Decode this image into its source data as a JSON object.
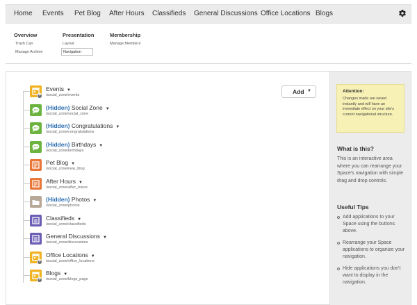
{
  "topnav": {
    "items": [
      "Home",
      "Events",
      "Pet Blog",
      "After Hours",
      "Classifieds",
      "General Discussions",
      "Office Locations",
      "Blogs"
    ]
  },
  "subnav": {
    "overview": {
      "title": "Overview",
      "links": [
        "Trash Can",
        "Manage Archive"
      ]
    },
    "presentation": {
      "title": "Presentation",
      "links": [
        "Layout"
      ],
      "input_value": "Navigation"
    },
    "membership": {
      "title": "Membership",
      "links": [
        "Manage Members"
      ]
    }
  },
  "add_button": {
    "label": "Add"
  },
  "tree": [
    {
      "hidden": "",
      "name": "Events",
      "path": "/social_zone/events",
      "icon": "calendar-icon",
      "color": "#f0b323",
      "plus": true
    },
    {
      "hidden": "(Hidden)",
      "name": "Social Zone",
      "path": "/social_zone/social_zone",
      "icon": "chat-icon",
      "color": "#6cb33f",
      "plus": false
    },
    {
      "hidden": "(Hidden)",
      "name": "Congratulations",
      "path": "/social_zone/congratulations",
      "icon": "chat-icon",
      "color": "#6cb33f",
      "plus": false
    },
    {
      "hidden": "(Hidden)",
      "name": "Birthdays",
      "path": "/social_zone/birthdays",
      "icon": "chat-icon",
      "color": "#6cb33f",
      "plus": false
    },
    {
      "hidden": "",
      "name": "Pet Blog",
      "path": "/social_zone/new_blog",
      "icon": "blog-icon",
      "color": "#e9773a",
      "plus": false
    },
    {
      "hidden": "",
      "name": "After Hours",
      "path": "/social_zone/after_hours",
      "icon": "blog-icon",
      "color": "#e9773a",
      "plus": false
    },
    {
      "hidden": "(Hidden)",
      "name": "Photos",
      "path": "/social_zone/photos",
      "icon": "folder-icon",
      "color": "#b7a898",
      "plus": false
    },
    {
      "hidden": "",
      "name": "Classifieds",
      "path": "/social_zone/classifieds",
      "icon": "list-icon",
      "color": "#6b5fb5",
      "plus": false
    },
    {
      "hidden": "",
      "name": "General Discussions",
      "path": "/social_zone/discussions",
      "icon": "list-icon",
      "color": "#6b5fb5",
      "plus": false
    },
    {
      "hidden": "",
      "name": "Office Locations",
      "path": "/social_zone/office_locations",
      "icon": "calendar-icon",
      "color": "#f0b323",
      "plus": true
    },
    {
      "hidden": "",
      "name": "Blogs",
      "path": "/social_zone/blogs_page",
      "icon": "calendar-icon",
      "color": "#f0b323",
      "plus": true
    }
  ],
  "sidebar": {
    "attention_title": "Attention:",
    "attention_body": "Changes made are saved instantly and will have an immediate effect on your site's current navigational structure.",
    "what_title": "What is this?",
    "what_body": "This is an interactive area where you can rearrange your Space's navigation with simple drag and drop controls.",
    "tips_title": "Useful Tips",
    "tips": [
      "Add applications to your Space using the buttons above.",
      "Rearrange your Space applications to organize your navigation.",
      "Hide applications you don't want to display in the navigation."
    ]
  }
}
